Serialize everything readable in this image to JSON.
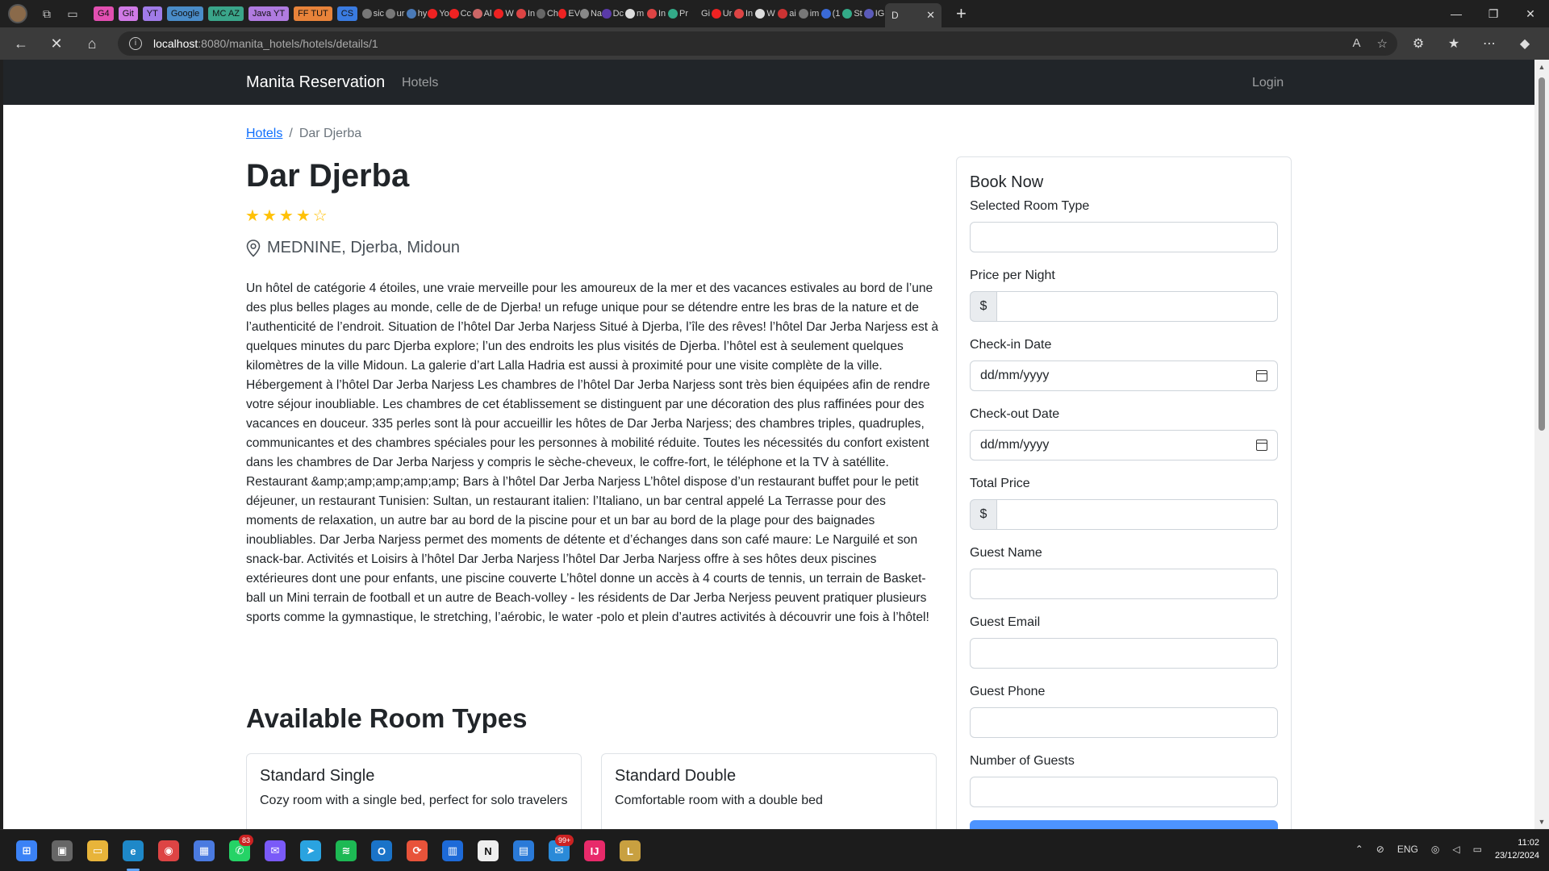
{
  "browser": {
    "bookmarks": [
      {
        "label": "G4",
        "color": "#e24fb1"
      },
      {
        "label": "Git",
        "color": "#d07ae6"
      },
      {
        "label": "YT",
        "color": "#a07be8"
      },
      {
        "label": "Google",
        "color": "#4a8cc8"
      },
      {
        "label": "MC AZ",
        "color": "#3aa58a"
      },
      {
        "label": "Java YT",
        "color": "#b07be0"
      },
      {
        "label": "FF TUT",
        "color": "#e8833a"
      },
      {
        "label": "CS",
        "color": "#3a7be0"
      }
    ],
    "tabs": [
      {
        "text": "sic",
        "color": "#777"
      },
      {
        "text": "ur",
        "color": "#777"
      },
      {
        "text": "hy",
        "color": "#4a7ab8"
      },
      {
        "text": "Yo",
        "color": "#e22"
      },
      {
        "text": "Cc",
        "color": "#e22"
      },
      {
        "text": "Al",
        "color": "#c66"
      },
      {
        "text": "W",
        "color": "#e22"
      },
      {
        "text": "In",
        "color": "#d44"
      },
      {
        "text": "Ch",
        "color": "#666"
      },
      {
        "text": "EV",
        "color": "#e22"
      },
      {
        "text": "Na",
        "color": "#888"
      },
      {
        "text": "Dc",
        "color": "#5a3aa8"
      },
      {
        "text": "m",
        "color": "#ddd"
      },
      {
        "text": "In",
        "color": "#d44"
      },
      {
        "text": "Pr",
        "color": "#3a8"
      },
      {
        "text": "Gi",
        "color": "#202020"
      },
      {
        "text": "Ur",
        "color": "#e22"
      },
      {
        "text": "In",
        "color": "#d44"
      },
      {
        "text": "W",
        "color": "#ddd"
      },
      {
        "text": "ai",
        "color": "#c33"
      },
      {
        "text": "im",
        "color": "#777"
      },
      {
        "text": "(1",
        "color": "#3a6ad8"
      },
      {
        "text": "St",
        "color": "#3a8"
      },
      {
        "text": "IG",
        "color": "#5a5ab8"
      }
    ],
    "active_tab": "D",
    "url_host": "localhost",
    "url_rest": ":8080/manita_hotels/hotels/details/1"
  },
  "nav": {
    "brand": "Manita Reservation",
    "hotels_link": "Hotels",
    "login_link": "Login"
  },
  "breadcrumb": {
    "parent": "Hotels",
    "separator": "/",
    "current": "Dar Djerba"
  },
  "hotel": {
    "name": "Dar Djerba",
    "rating": 4,
    "max_rating": 5,
    "location": "MEDNINE, Djerba, Midoun",
    "description": "Un hôtel de catégorie 4 étoiles, une vraie merveille pour les amoureux de la mer et des vacances estivales au bord de l’une des plus belles plages au monde, celle de de Djerba! un refuge unique pour se détendre entre les bras de la nature et de l’authenticité de l’endroit. Situation de l’hôtel Dar Jerba Narjess Situé à Djerba, l’île des rêves! l’hôtel Dar Jerba Narjess est à quelques minutes du parc Djerba explore; l’un des endroits les plus visités de Djerba. l’hôtel est à seulement quelques kilomètres de la ville Midoun. La galerie d’art Lalla Hadria est aussi à proximité pour une visite complète de la ville. Hébergement à l’hôtel Dar Jerba Narjess Les chambres de l’hôtel Dar Jerba Narjess sont très bien équipées afin de rendre votre séjour inoubliable. Les chambres de cet établissement se distinguent par une décoration des plus raffinées pour des vacances en douceur. 335 perles sont là pour accueillir les hôtes de Dar Jerba Narjess; des chambres triples, quadruples, communicantes et des chambres spéciales pour les personnes à mobilité réduite. Toutes les nécessités du confort existent dans les chambres de Dar Jerba Narjess y compris le sèche-cheveux, le coffre-fort, le téléphone et la TV à satéllite. Restaurant &amp;amp;amp;amp;amp; Bars à l’hôtel Dar Jerba Narjess L’hôtel dispose d’un restaurant buffet pour le petit déjeuner, un restaurant Tunisien: Sultan, un restaurant italien: l’Italiano, un bar central appelé La Terrasse pour des moments de relaxation, un autre bar au bord de la piscine pour et un bar au bord de la plage pour des baignades inoubliables. Dar Jerba Narjess permet des moments de détente et d’échanges dans son café maure: Le Narguilé et son snack-bar. Activités et Loisirs à l’hôtel Dar Jerba Narjess l’hôtel Dar Jerba Narjess offre à ses hôtes deux piscines extérieures dont une pour enfants, une piscine couverte L’hôtel donne un accès à 4 courts de tennis, un terrain de Basket-ball un Mini terrain de football et un autre de Beach-volley - les résidents de Dar Jerba Nerjess peuvent pratiquer plusieurs sports comme la gymnastique, le stretching, l’aérobic, le water -polo et plein d’autres activités à découvrir une fois à l’hôtel!"
  },
  "rooms": {
    "title": "Available Room Types",
    "items": [
      {
        "name": "Standard Single",
        "description": "Cozy room with a single bed, perfect for solo travelers"
      },
      {
        "name": "Standard Double",
        "description": "Comfortable room with a double bed"
      }
    ]
  },
  "booking": {
    "title": "Book Now",
    "room_type_label": "Selected Room Type",
    "price_label": "Price per Night",
    "currency": "$",
    "checkin_label": "Check-in Date",
    "checkin_placeholder": "dd/mm/yyyy",
    "checkout_label": "Check-out Date",
    "checkout_placeholder": "dd/mm/yyyy",
    "total_label": "Total Price",
    "guest_name_label": "Guest Name",
    "guest_email_label": "Guest Email",
    "guest_phone_label": "Guest Phone",
    "guests_label": "Number of Guests"
  },
  "taskbar": {
    "apps": [
      {
        "name": "start",
        "color": "#3b82f6",
        "glyph": "⊞"
      },
      {
        "name": "task-view",
        "color": "#666",
        "glyph": "▣"
      },
      {
        "name": "file-explorer",
        "color": "#e8b43a",
        "glyph": "▭"
      },
      {
        "name": "edge",
        "color": "#1e88c8",
        "glyph": "e"
      },
      {
        "name": "chrome",
        "color": "#d44",
        "glyph": "◉"
      },
      {
        "name": "store",
        "color": "#4a7ae0",
        "glyph": "▦"
      },
      {
        "name": "whatsapp",
        "color": "#25d366",
        "glyph": "✆"
      },
      {
        "name": "messenger",
        "color": "#7a5af8",
        "glyph": "✉"
      },
      {
        "name": "telegram",
        "color": "#2aa3e0",
        "glyph": "➤"
      },
      {
        "name": "spotify",
        "color": "#1db954",
        "glyph": "≋"
      },
      {
        "name": "outlook",
        "color": "#1a73c8",
        "glyph": "O"
      },
      {
        "name": "postman",
        "color": "#e8533a",
        "glyph": "⟳"
      },
      {
        "name": "trello",
        "color": "#1d6ad8",
        "glyph": "▥"
      },
      {
        "name": "notion",
        "color": "#eee",
        "glyph": "N"
      },
      {
        "name": "notepad",
        "color": "#2a7ad8",
        "glyph": "▤"
      },
      {
        "name": "mail",
        "color": "#2a8ad8",
        "glyph": "✉"
      },
      {
        "name": "intellij",
        "color": "#e82a6a",
        "glyph": "IJ"
      },
      {
        "name": "league",
        "color": "#c8a040",
        "glyph": "L"
      }
    ],
    "whatsapp_badge": "83",
    "mail_badge": "99+",
    "language": "ENG",
    "time": "11:02",
    "date": "23/12/2024"
  }
}
